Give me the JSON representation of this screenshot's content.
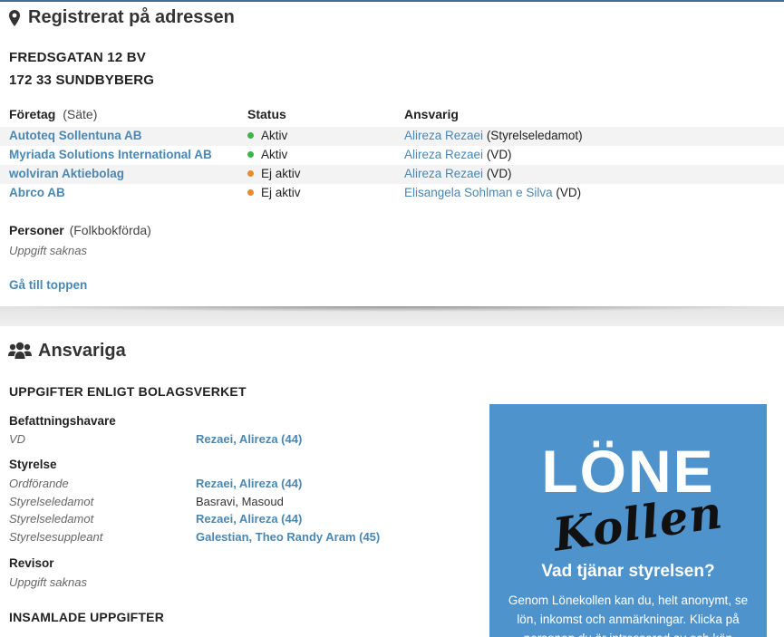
{
  "address_section": {
    "title": "Registrerat på adressen",
    "street": "FREDSGATAN 12 BV",
    "postal": "172 33 SUNDBYBERG",
    "col_company": "Företag",
    "col_company_note": "(Säte)",
    "col_status": "Status",
    "col_responsible": "Ansvarig",
    "rows": [
      {
        "company": "Autoteq Sollentuna AB",
        "status": "Aktiv",
        "status_color": "#3cb44b",
        "person": "Alireza Rezaei",
        "role": "(Styrelseledamot)"
      },
      {
        "company": "Myriada Solutions International AB",
        "status": "Aktiv",
        "status_color": "#3cb44b",
        "person": "Alireza Rezaei",
        "role": "(VD)"
      },
      {
        "company": "wolviran Aktiebolag",
        "status": "Ej aktiv",
        "status_color": "#e88a2e",
        "person": "Alireza Rezaei",
        "role": "(VD)"
      },
      {
        "company": "Abrco AB",
        "status": "Ej aktiv",
        "status_color": "#e88a2e",
        "person": "Elisangela Sohlman e Silva",
        "role": "(VD)"
      }
    ],
    "persons_label": "Personer",
    "persons_note": "(Folkbokförda)",
    "persons_value": "Uppgift saknas",
    "to_top": "Gå till toppen"
  },
  "responsible_section": {
    "title": "Ansvariga",
    "subtitle": "UPPGIFTER ENLIGT BOLAGSVERKET",
    "groups": {
      "befattning": {
        "label": "Befattningshavare",
        "items": [
          {
            "role": "VD",
            "name": "Rezaei, Alireza (44)"
          }
        ]
      },
      "styrelse": {
        "label": "Styrelse",
        "items": [
          {
            "role": "Ordförande",
            "name": "Rezaei, Alireza (44)"
          },
          {
            "role": "Styrelseledamot",
            "name": "Basravi, Masoud"
          },
          {
            "role": "Styrelseledamot",
            "name": "Rezaei, Alireza (44)"
          },
          {
            "role": "Styrelsesuppleant",
            "name": "Galestian, Theo Randy Aram (45)"
          }
        ]
      },
      "revisor": {
        "label": "Revisor",
        "value": "Uppgift saknas"
      }
    },
    "collected": "INSAMLADE UPPGIFTER"
  },
  "ad": {
    "logo_top": "LÖNE",
    "logo_bottom": "Kollen",
    "question": "Vad tjänar styrelsen?",
    "body": "Genom Lönekollen kan du, helt anonymt, se lön, inkomst och anmärkningar. Klicka på personen du är intresserad av och kön"
  },
  "colors": {
    "link": "#4a87b3",
    "ad_bg": "#4f93cd",
    "active": "#3cb44b",
    "inactive": "#e88a2e"
  }
}
